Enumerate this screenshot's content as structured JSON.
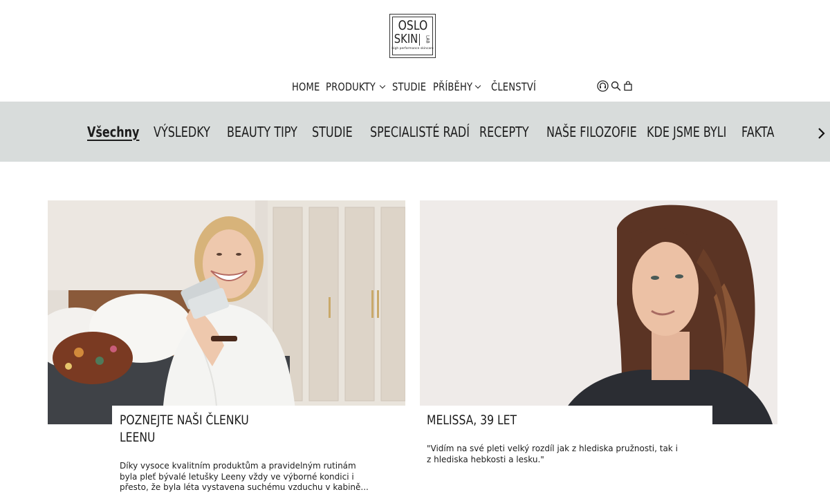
{
  "brand": {
    "logo_line1": "OSLO",
    "logo_line2": "SKIN",
    "logo_lab": "LAB",
    "logo_tagline": "high performance skincare"
  },
  "nav": {
    "items": [
      {
        "label": "HOME",
        "has_dropdown": false
      },
      {
        "label": "PRODUKTY",
        "has_dropdown": true
      },
      {
        "label": "STUDIE",
        "has_dropdown": false
      },
      {
        "label": "PŘÍBĚHY",
        "has_dropdown": true
      },
      {
        "label": "ČLENSTVÍ",
        "has_dropdown": false
      }
    ],
    "icons": [
      "headset-icon",
      "search-icon",
      "cart-icon"
    ]
  },
  "categories": {
    "items": [
      {
        "label": "Všechny",
        "active": true
      },
      {
        "label": "VÝSLEDKY",
        "active": false
      },
      {
        "label": "BEAUTY TIPY",
        "active": false
      },
      {
        "label": "STUDIE",
        "active": false
      },
      {
        "label": "SPECIALISTÉ RADÍ",
        "active": false
      },
      {
        "label": "RECEPTY",
        "active": false
      },
      {
        "label": "NAŠE FILOZOFIE",
        "active": false
      },
      {
        "label": "KDE JSME BYLI",
        "active": false
      },
      {
        "label": "FAKTA",
        "active": false
      }
    ],
    "next_icon": "chevron-right-icon"
  },
  "cards": [
    {
      "title_line1": "POZNEJTE NAŠI ČLENKU",
      "title_line2": "LEENU",
      "excerpt_line1": "Díky vysoce kvalitním produktům a pravidelným rutinám",
      "excerpt_line2": "byla pleť bývalé letušky Leeny vždy ve výborné kondici i",
      "excerpt_line3": "přesto, že byla léta vystavena suchému vzduchu v kabině..."
    },
    {
      "title_line1": "MELISSA, 39 LET",
      "excerpt_line1": "\"Vidím na své pleti velký rozdíl jak z hlediska pružnosti, tak i",
      "excerpt_line2": "z hlediska hebkosti a lesku.\""
    }
  ],
  "colors": {
    "category_bar_bg": "#d8dcdb",
    "text": "#1c1c1c",
    "background": "#ffffff"
  }
}
